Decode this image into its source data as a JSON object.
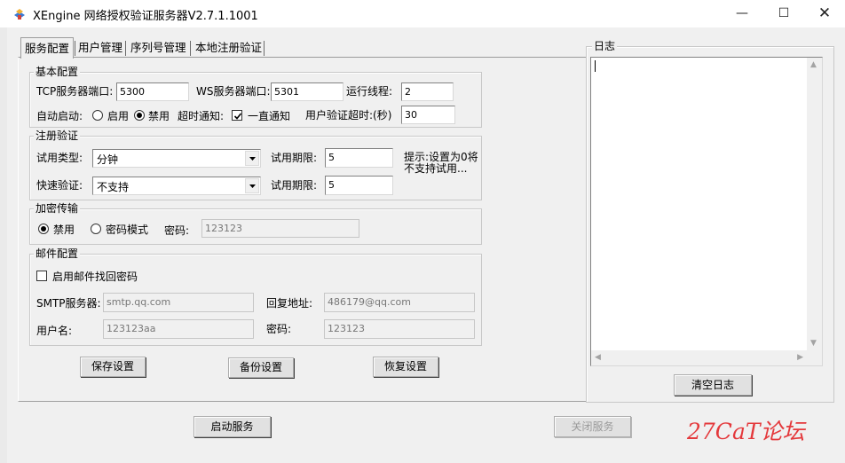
{
  "window": {
    "title": "XEngine 网络授权验证服务器V2.7.1.1001",
    "minimize_glyph": "—",
    "maximize_glyph": "☐",
    "close_glyph": "✕",
    "app_icon": "app-logo-icon"
  },
  "tabs": [
    {
      "label": "服务配置",
      "active": true
    },
    {
      "label": "用户管理"
    },
    {
      "label": "序列号管理"
    },
    {
      "label": "本地注册验证"
    }
  ],
  "basic": {
    "group_label": "基本配置",
    "tcp_port_label": "TCP服务器端口:",
    "tcp_port_value": "5300",
    "ws_port_label": "WS服务器端口:",
    "ws_port_value": "5301",
    "threads_label": "运行线程:",
    "threads_value": "2",
    "autostart_label": "自动启动:",
    "autostart_enable": "启用",
    "autostart_disable": "禁用",
    "autostart_selected": "禁用",
    "timeout_notify_label": "超时通知:",
    "timeout_notify_option": "一直通知",
    "timeout_notify_checked": true,
    "user_timeout_label": "用户验证超时:(秒)",
    "user_timeout_value": "30"
  },
  "register": {
    "group_label": "注册验证",
    "trial_type_label": "试用类型:",
    "trial_type_value": "分钟",
    "trial_period_label": "试用期限:",
    "trial_period_value": "5",
    "hint_line1": "提示:设置为0将",
    "hint_line2": "不支持试用...",
    "quick_verify_label": "快速验证:",
    "quick_verify_value": "不支持",
    "quick_period_label": "试用期限:",
    "quick_period_value": "5"
  },
  "encrypt": {
    "group_label": "加密传输",
    "disable_label": "禁用",
    "password_mode_label": "密码模式",
    "selected": "禁用",
    "password_label": "密码:",
    "password_value": "123123"
  },
  "mail": {
    "group_label": "邮件配置",
    "enable_label": "启用邮件找回密码",
    "enable_checked": false,
    "smtp_label": "SMTP服务器:",
    "smtp_value": "smtp.qq.com",
    "reply_label": "回复地址:",
    "reply_value": "486179@qq.com",
    "user_label": "用户名:",
    "user_value": "123123aa",
    "pass_label": "密码:",
    "pass_value": "123123"
  },
  "buttons": {
    "save": "保存设置",
    "backup": "备份设置",
    "restore": "恢复设置",
    "start": "启动服务",
    "stop": "关闭服务",
    "clear_log": "清空日志"
  },
  "log": {
    "group_label": "日志",
    "content": ""
  },
  "watermark": "27CaT论坛"
}
